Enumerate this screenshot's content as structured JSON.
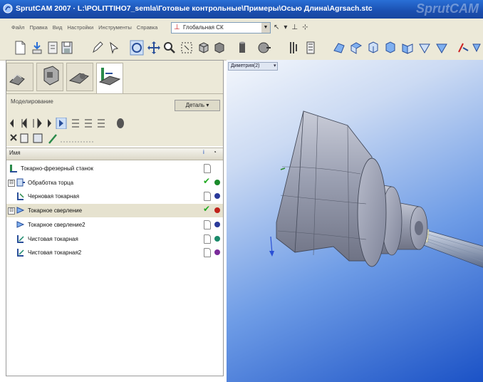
{
  "window": {
    "title": "SprutCAM 2007 · L:\\POLITTIHO7_semla\\Готовые контрольные\\Примеры\\Осью Длина\\Agrsach.stc",
    "brand_watermark": "SprutCAM"
  },
  "menu": {
    "items": [
      "Файл",
      "Правка",
      "Вид",
      "Настройки",
      "Инструменты",
      "Справка"
    ],
    "coordinate_system": "Глобальная СК"
  },
  "left_panel": {
    "header_label": "Моделирование",
    "header_button": "Деталь"
  },
  "columns": {
    "name": "Имя",
    "col1": "i",
    "col2": "◔"
  },
  "operations": [
    {
      "label": "Токарно-фрезерный станок",
      "level": 0,
      "expander": "",
      "icon": "machine-icon",
      "check": false,
      "dot": ""
    },
    {
      "label": "Обработка торца",
      "level": 1,
      "expander": "⊟",
      "icon": "face-turning-icon",
      "check": true,
      "dot": "#1a8a2a"
    },
    {
      "label": "Черновая токарная",
      "level": 1,
      "expander": "",
      "icon": "roughing-icon",
      "check": false,
      "dot": "#2a3a9a"
    },
    {
      "label": "Токарное сверление",
      "level": 1,
      "expander": "⊟",
      "icon": "drilling-icon",
      "check": true,
      "dot": "#c0221a",
      "selected": true
    },
    {
      "label": "Токарное сверление2",
      "level": 1,
      "expander": "",
      "icon": "drilling-icon",
      "check": false,
      "dot": "#2a3a9a"
    },
    {
      "label": "Чистовая токарная",
      "level": 1,
      "expander": "",
      "icon": "finishing-icon",
      "check": false,
      "dot": "#1a8a6a"
    },
    {
      "label": "Чистовая токарная2",
      "level": 1,
      "expander": "",
      "icon": "finishing-icon",
      "check": false,
      "dot": "#7a2a9a"
    }
  ],
  "viewport": {
    "view_name": "Диметрия(2)"
  },
  "colors": {
    "titlebar": "#1a4fb0",
    "chrome": "#ece9d8",
    "viewport_deep": "#1b52c6",
    "part": "#8e93a6"
  }
}
